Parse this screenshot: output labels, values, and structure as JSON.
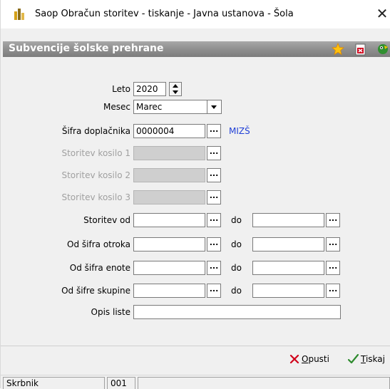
{
  "window": {
    "title": "Saop Obračun storitev - tiskanje - Javna ustanova - Šola",
    "close_glyph": "✕"
  },
  "header": {
    "title": "Subvencije šolske prehrane",
    "icons": [
      "star-icon",
      "pdf-export-icon",
      "assistant-icon"
    ]
  },
  "form": {
    "leto": {
      "label": "Leto",
      "value": "2020"
    },
    "mesec": {
      "label": "Mesec",
      "value": "Marec"
    },
    "sifra_doplacnika": {
      "label": "Šifra doplačnika",
      "value": "0000004",
      "link": "MIZŠ"
    },
    "storitev_kosilo_1": {
      "label": "Storitev kosilo 1",
      "value": ""
    },
    "storitev_kosilo_2": {
      "label": "Storitev kosilo 2",
      "value": ""
    },
    "storitev_kosilo_3": {
      "label": "Storitev kosilo 3",
      "value": ""
    },
    "storitev_od": {
      "label": "Storitev od",
      "value": "",
      "do_label": "do",
      "do_value": ""
    },
    "sifra_otroka": {
      "label": "Od šifra otroka",
      "value": "",
      "do_label": "do",
      "do_value": ""
    },
    "sifra_enote": {
      "label": "Od šifra enote",
      "value": "",
      "do_label": "do",
      "do_value": ""
    },
    "sifre_skupine": {
      "label": "Od šifre skupine",
      "value": "",
      "do_label": "do",
      "do_value": ""
    },
    "opis_liste": {
      "label": "Opis liste",
      "value": ""
    },
    "dots": "..."
  },
  "footer": {
    "cancel": {
      "access_key": "O",
      "rest": "pusti"
    },
    "print": {
      "access_key": "T",
      "rest": "iskaj"
    }
  },
  "status": {
    "user": "Skrbnik",
    "code": "001"
  },
  "colors": {
    "link": "#1f3fd6",
    "header_bar": "#8f8f8f",
    "cancel_red": "#d0021b",
    "ok_green": "#2e8b2e"
  }
}
